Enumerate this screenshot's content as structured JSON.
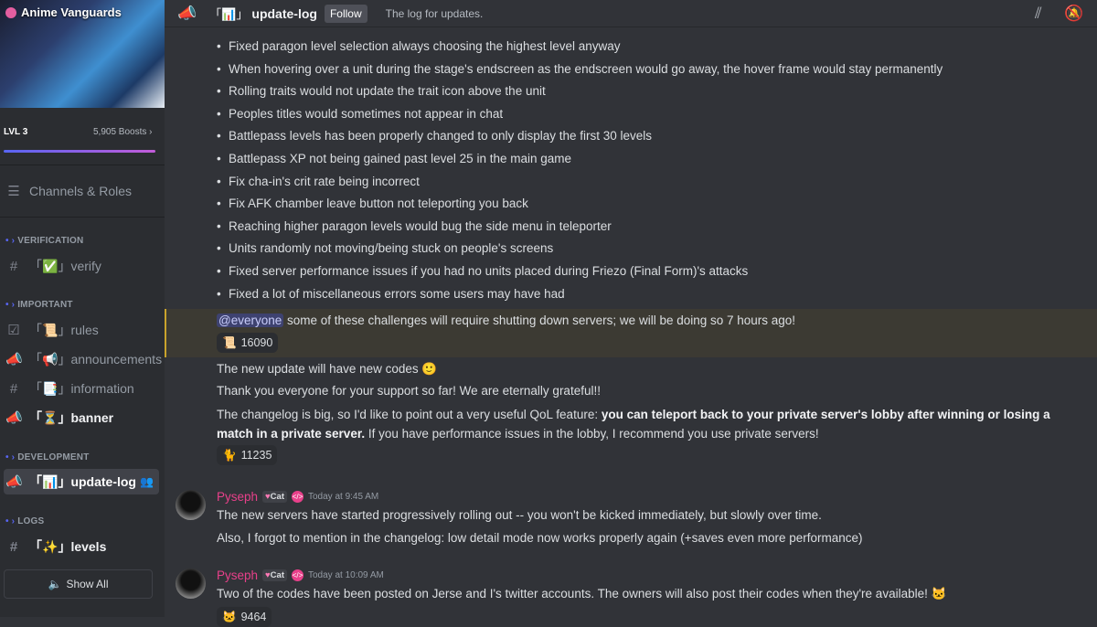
{
  "server": {
    "name": "Anime Vanguards",
    "level": "LVL 3",
    "boosts": "5,905 Boosts",
    "boost_progress": 0.97,
    "channels_roles": "Channels & Roles",
    "show_all": "Show All"
  },
  "categories": [
    {
      "label": "VERIFICATION",
      "channels": [
        {
          "icon": "hash",
          "emoji": "✅",
          "name": "verify"
        }
      ]
    },
    {
      "label": "IMPORTANT",
      "channels": [
        {
          "icon": "rules",
          "emoji": "📜",
          "name": "rules"
        },
        {
          "icon": "megaphone",
          "emoji": "📢",
          "name": "announcements"
        },
        {
          "icon": "hash",
          "emoji": "📑",
          "name": "information"
        },
        {
          "icon": "megaphone",
          "emoji": "⏳",
          "name": "banner"
        }
      ]
    },
    {
      "label": "DEVELOPMENT",
      "channels": [
        {
          "icon": "megaphone",
          "emoji": "📊",
          "name": "update-log"
        }
      ]
    },
    {
      "label": "LOGS",
      "channels": [
        {
          "icon": "hash",
          "emoji": "✨",
          "name": "levels"
        }
      ]
    }
  ],
  "header": {
    "channel_emoji": "📊",
    "channel": "update-log",
    "follow": "Follow",
    "topic": "The log for updates."
  },
  "bullets": [
    "Fixed paragon level selection always choosing the highest level anyway",
    "When hovering over a unit during the stage's endscreen as the endscreen would go away, the hover frame would stay permanently",
    "Rolling traits would not update the trait icon above the unit",
    "Peoples titles would sometimes not appear in chat",
    "Battlepass levels has been properly changed to only display the first 30 levels",
    "Battlepass XP not being gained past level 25 in the main game",
    "Fix cha-in's crit rate being incorrect",
    "Fix AFK chamber leave button not teleporting you back",
    "Reaching higher paragon levels would bug the side menu in teleporter",
    "Units randomly not moving/being stuck on people's screens",
    "Fixed server performance issues if you had no units placed during Friezo (Final Form)'s attacks",
    "Fixed a lot of miscellaneous errors some users may have had"
  ],
  "mention_msg": {
    "mention": "@everyone",
    "text": " some of these challenges will require shutting down servers; we will be doing so 7 hours ago!",
    "reaction_count": "16090"
  },
  "codes_msg": {
    "line1": "The new update will have new codes 🙂",
    "line2": "Thank you everyone for your support so far! We are eternally grateful!!",
    "line3_pre": "The changelog is big, so I'd like to point out a very useful QoL feature: ",
    "line3_bold": "you can teleport back to your private server's lobby after winning or losing a match in a private server.",
    "line3_post": " If you",
    "line4": "have performance issues in the lobby, I recommend you use private servers!",
    "reaction_count": "11235"
  },
  "messages": [
    {
      "author": "Pyseph",
      "tag": "Cat",
      "time": "Today at 9:45 AM",
      "lines": [
        "The new servers have started progressively rolling out -- you won't be kicked immediately, but slowly over time.",
        "Also, I forgot to mention in the changelog: low detail mode now works properly again (+saves even more performance)"
      ]
    },
    {
      "author": "Pyseph",
      "tag": "Cat",
      "time": "Today at 10:09 AM",
      "lines": [
        "Two of the codes have been posted on Jerse and I's twitter accounts. The owners will also post their codes when they're available! 🐱"
      ],
      "reaction_count": "9464"
    }
  ],
  "colors": {
    "accent": "#5865f2",
    "username": "#e8408a",
    "mention_highlight": "#c9a32c"
  }
}
